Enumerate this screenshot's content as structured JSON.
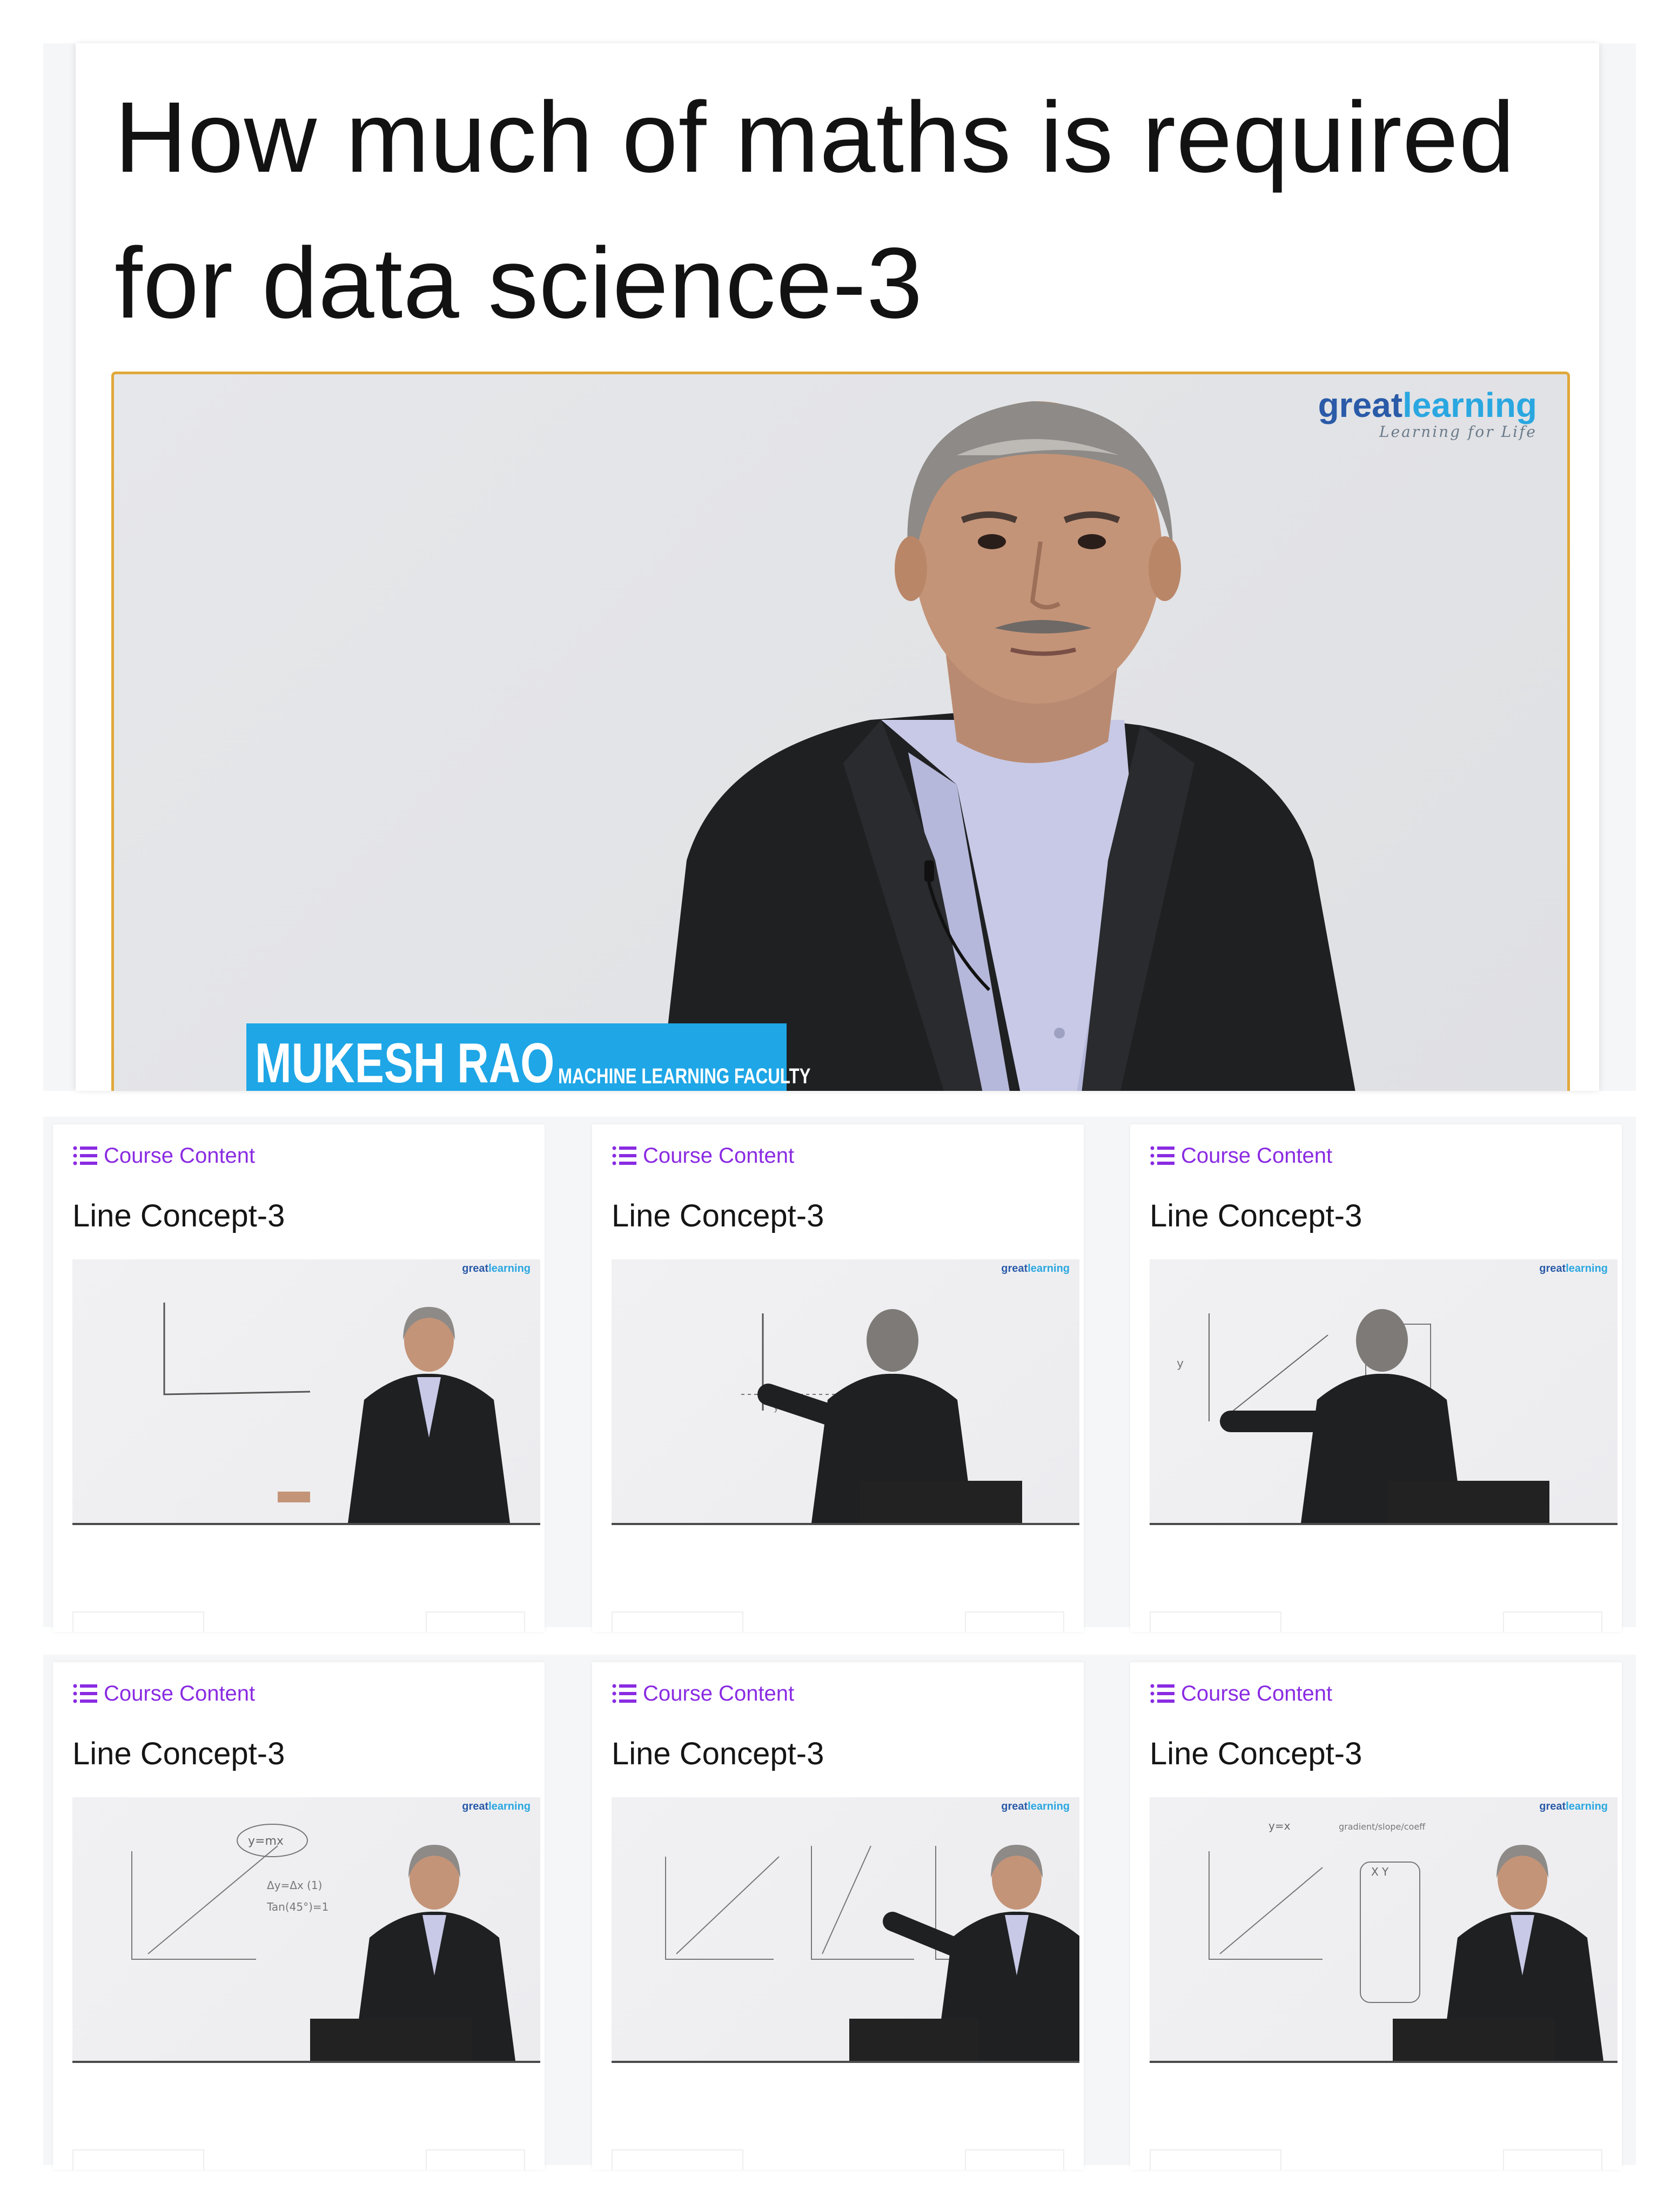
{
  "hero": {
    "title": "How much of maths is required for data science-3",
    "brand": {
      "great": "great",
      "learning": "learning",
      "tagline": "Learning for Life"
    },
    "nameplate": {
      "name": "MUKESH RAO",
      "role": "MACHINE LEARNING FACULTY"
    }
  },
  "cards": [
    {
      "link_label": "Course Content",
      "title": "Line Concept-3",
      "scene": "axes-turned"
    },
    {
      "link_label": "Course Content",
      "title": "Line Concept-3",
      "scene": "drawing-axis"
    },
    {
      "link_label": "Course Content",
      "title": "Line Concept-3",
      "scene": "drawing-table"
    },
    {
      "link_label": "Course Content",
      "title": "Line Concept-3",
      "scene": "explaining-slope"
    },
    {
      "link_label": "Course Content",
      "title": "Line Concept-3",
      "scene": "pointing-graph"
    },
    {
      "link_label": "Course Content",
      "title": "Line Concept-3",
      "scene": "explaining-table"
    }
  ],
  "thumb_brand": {
    "great": "great",
    "learning": "learning"
  },
  "colors": {
    "accent": "#8a2be2",
    "nameplate": "#1ea6e6",
    "video_border": "#e0a83a",
    "brand_dark": "#2a5aa8",
    "brand_light": "#2aa7e0"
  }
}
